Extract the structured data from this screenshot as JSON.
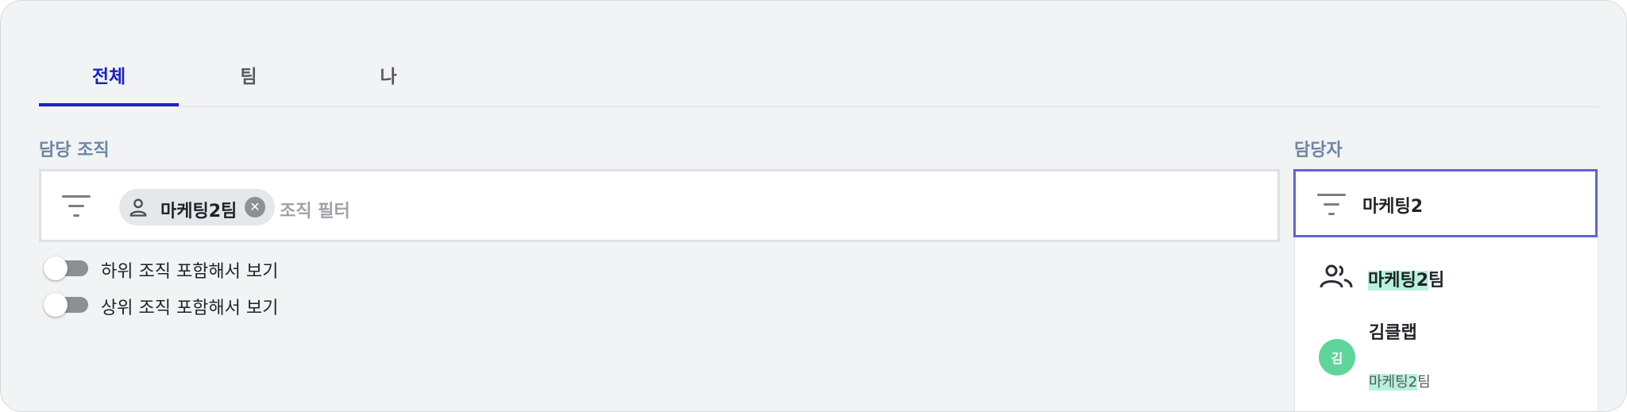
{
  "tabs": [
    {
      "label": "전체",
      "active": true
    },
    {
      "label": "팀",
      "active": false
    },
    {
      "label": "나",
      "active": false
    }
  ],
  "org_filter": {
    "label": "담당 조직",
    "chip": {
      "label": "마케팅2팀",
      "icon": "person-icon"
    },
    "placeholder": "조직 필터"
  },
  "toggles": [
    {
      "label": "하위 조직 포함해서 보기",
      "on": false
    },
    {
      "label": "상위 조직 포함해서 보기",
      "on": false
    }
  ],
  "assignee": {
    "label": "담당자",
    "search_value": "마케팅2",
    "options": [
      {
        "type": "team",
        "icon": "group-icon",
        "match": "마케팅2",
        "rest": "팀"
      },
      {
        "type": "user",
        "avatar": "김",
        "name": "김클랩",
        "sub_match": "마케팅2",
        "sub_rest": "팀"
      }
    ]
  },
  "colors": {
    "accent": "#1a22c4",
    "search_border": "#5f64d6",
    "highlight": "#b8f1dc",
    "avatar": "#5fd49b",
    "label": "#6c86a3"
  }
}
